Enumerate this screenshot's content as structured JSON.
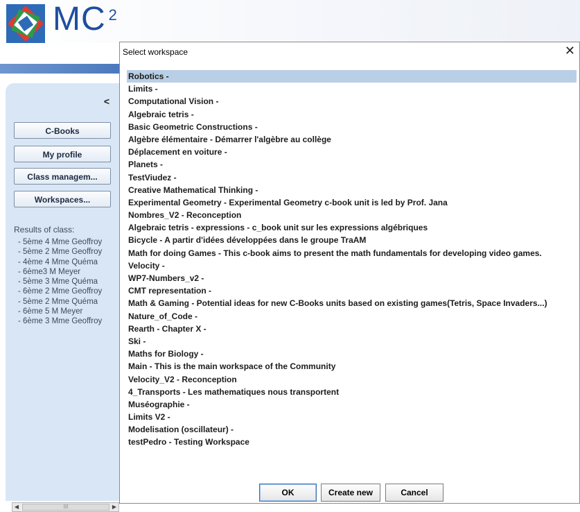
{
  "header": {
    "brand": "MC",
    "brand_sup": "2"
  },
  "sidebar": {
    "collapse_label": "<",
    "buttons": [
      "C-Books",
      "My profile",
      "Class managem...",
      "Workspaces..."
    ],
    "results_title": "Results of class:",
    "results": [
      "- 5ème 4 Mme Geoffroy",
      "- 5ème 2 Mme Geoffroy",
      "- 4ème 4 Mme Quéma",
      "- 6ème3 M Meyer",
      "- 5ème 3 Mme Quéma",
      "- 6ème 2 Mme Geoffroy",
      "- 5ème 2 Mme Quéma",
      "- 6ème 5 M Meyer",
      "- 6ème 3 Mme Geoffroy"
    ],
    "scroll_thumb_glyph": "III"
  },
  "dialog": {
    "title": "Select workspace",
    "close_glyph": "✕",
    "selected_index": 0,
    "workspaces": [
      "Robotics -",
      "Limits -",
      "Computational Vision -",
      "Algebraic tetris -",
      "Basic Geometric Constructions -",
      "Algèbre élémentaire - Démarrer l'algèbre au collège",
      "Déplacement en voiture -",
      "Planets -",
      "TestViudez -",
      "Creative Mathematical Thinking -",
      "Experimental Geometry - Experimental Geometry c-book unit is led by Prof. Jana",
      "Nombres_V2 - Reconception",
      "Algebraic tetris - expressions - c_book unit sur les expressions algébriques",
      "Bicycle - A partir d'idées développées dans le groupe TraAM",
      "Math for doing Games - This c-book aims to present the math fundamentals for developing video games.",
      "Velocity -",
      "WP7-Numbers_v2 -",
      "CMT representation -",
      "Math & Gaming - Potential ideas for new C-Books units based on existing games(Tetris, Space Invaders...)",
      "Nature_of_Code -",
      "Rearth - Chapter X -",
      "Ski -",
      "Maths for Biology -",
      "Main - This is the main workspace of the Community",
      "Velocity_V2 - Reconception",
      "4_Transports - Les mathematiques nous transportent",
      "Muséographie -",
      "Limits V2 -",
      "Modelisation (oscillateur) -",
      "testPedro - Testing Workspace"
    ],
    "buttons": {
      "ok": "OK",
      "create": "Create new",
      "cancel": "Cancel"
    }
  },
  "colors": {
    "brand": "#1f4e9e",
    "selection": "#b8cfe5",
    "panel": "#d9e6f5",
    "band": "#4b79bd"
  }
}
